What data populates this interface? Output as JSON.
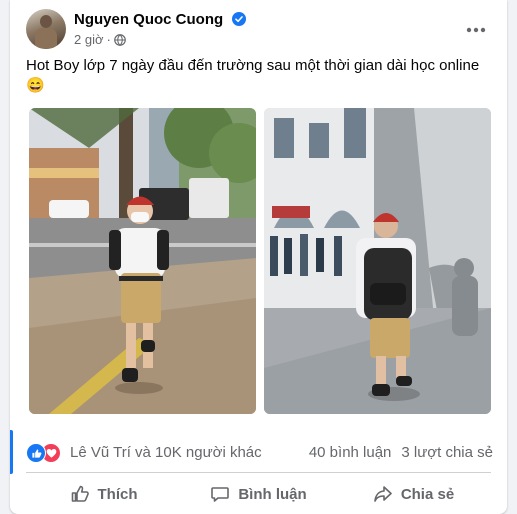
{
  "post": {
    "author_name": "Nguyen Quoc Cuong",
    "time": "2 giờ",
    "time_separator": "·",
    "caption": "Hot Boy lớp 7 ngày đầu đến trường sau một thời gian dài học online",
    "caption_emoji": "😄",
    "verified_icon": "verified-badge-icon",
    "audience_icon": "globe-icon"
  },
  "stats": {
    "reactions_text": "Lê Vũ Trí và 10K người khác",
    "comments": "40 bình luận",
    "shares": "3 lượt chia sẻ",
    "reaction_icons": [
      "like-icon",
      "love-icon"
    ]
  },
  "actions": {
    "like": "Thích",
    "comment": "Bình luận",
    "share": "Chia sẻ"
  },
  "colors": {
    "brand_blue": "#1877f2",
    "love_red": "#f33e58",
    "secondary_text": "#65676b"
  }
}
